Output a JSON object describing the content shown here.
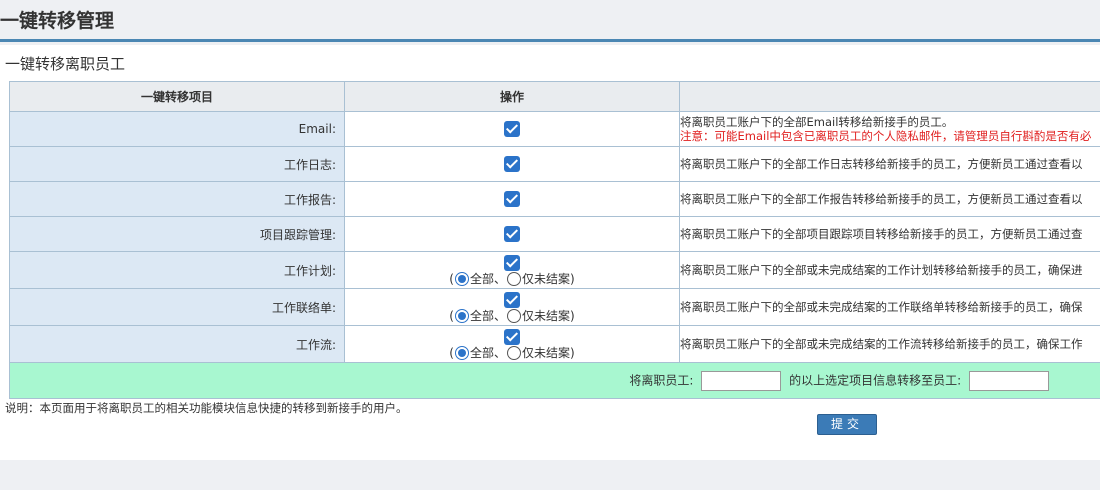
{
  "page": {
    "title": "一键转移管理",
    "section_title": "一键转移离职员工"
  },
  "table": {
    "headers": [
      "一键转移项目",
      "操作",
      ""
    ],
    "rows": [
      {
        "label": "Email:",
        "checked": true,
        "has_radio": false,
        "desc": "将离职员工账户下的全部Email转移给新接手的员工。",
        "warning": "注意：可能Email中包含已离职员工的个人隐私邮件，请管理员自行斟酌是否有必"
      },
      {
        "label": "工作日志:",
        "checked": true,
        "has_radio": false,
        "desc": "将离职员工账户下的全部工作日志转移给新接手的员工，方便新员工通过查看以"
      },
      {
        "label": "工作报告:",
        "checked": true,
        "has_radio": false,
        "desc": "将离职员工账户下的全部工作报告转移给新接手的员工，方便新员工通过查看以"
      },
      {
        "label": "项目跟踪管理:",
        "checked": true,
        "has_radio": false,
        "desc": "将离职员工账户下的全部项目跟踪项目转移给新接手的员工，方便新员工通过查"
      },
      {
        "label": "工作计划:",
        "checked": true,
        "has_radio": true,
        "desc": "将离职员工账户下的全部或未完成结案的工作计划转移给新接手的员工，确保进"
      },
      {
        "label": "工作联络单:",
        "checked": true,
        "has_radio": true,
        "desc": "将离职员工账户下的全部或未完成结案的工作联络单转移给新接手的员工，确保"
      },
      {
        "label": "工作流:",
        "checked": true,
        "has_radio": true,
        "desc": "将离职员工账户下的全部或未完成结案的工作流转移给新接手的员工，确保工作"
      }
    ],
    "radio": {
      "open": "(",
      "all": "全部、",
      "pending": "仅未结案",
      "close": ")"
    }
  },
  "footer": {
    "from_label": "将离职员工:",
    "from_value": "",
    "to_label": "的以上选定项目信息转移至员工:",
    "to_value": ""
  },
  "note": "说明：本页面用于将离职员工的相关功能模块信息快捷的转移到新接手的用户。",
  "submit_label": "提交"
}
